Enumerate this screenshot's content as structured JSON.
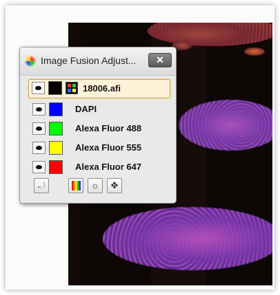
{
  "dialog": {
    "title": "Image Fusion Adjust...",
    "close_label": "✕",
    "file_row": {
      "label": "18006.afi",
      "swatch_color": "#000000"
    },
    "channels": [
      {
        "label": "DAPI",
        "color": "#0000ff"
      },
      {
        "label": "Alexa Fluor 488",
        "color": "#00ff00"
      },
      {
        "label": "Alexa Fluor 555",
        "color": "#ffff00"
      },
      {
        "label": "Alexa Fluor 647",
        "color": "#ff0000"
      }
    ],
    "toolbar": {
      "reset_icon": "⤾",
      "palette_icon": "palette-icon",
      "brightness_icon": "☼",
      "move_icon": "✥"
    }
  }
}
